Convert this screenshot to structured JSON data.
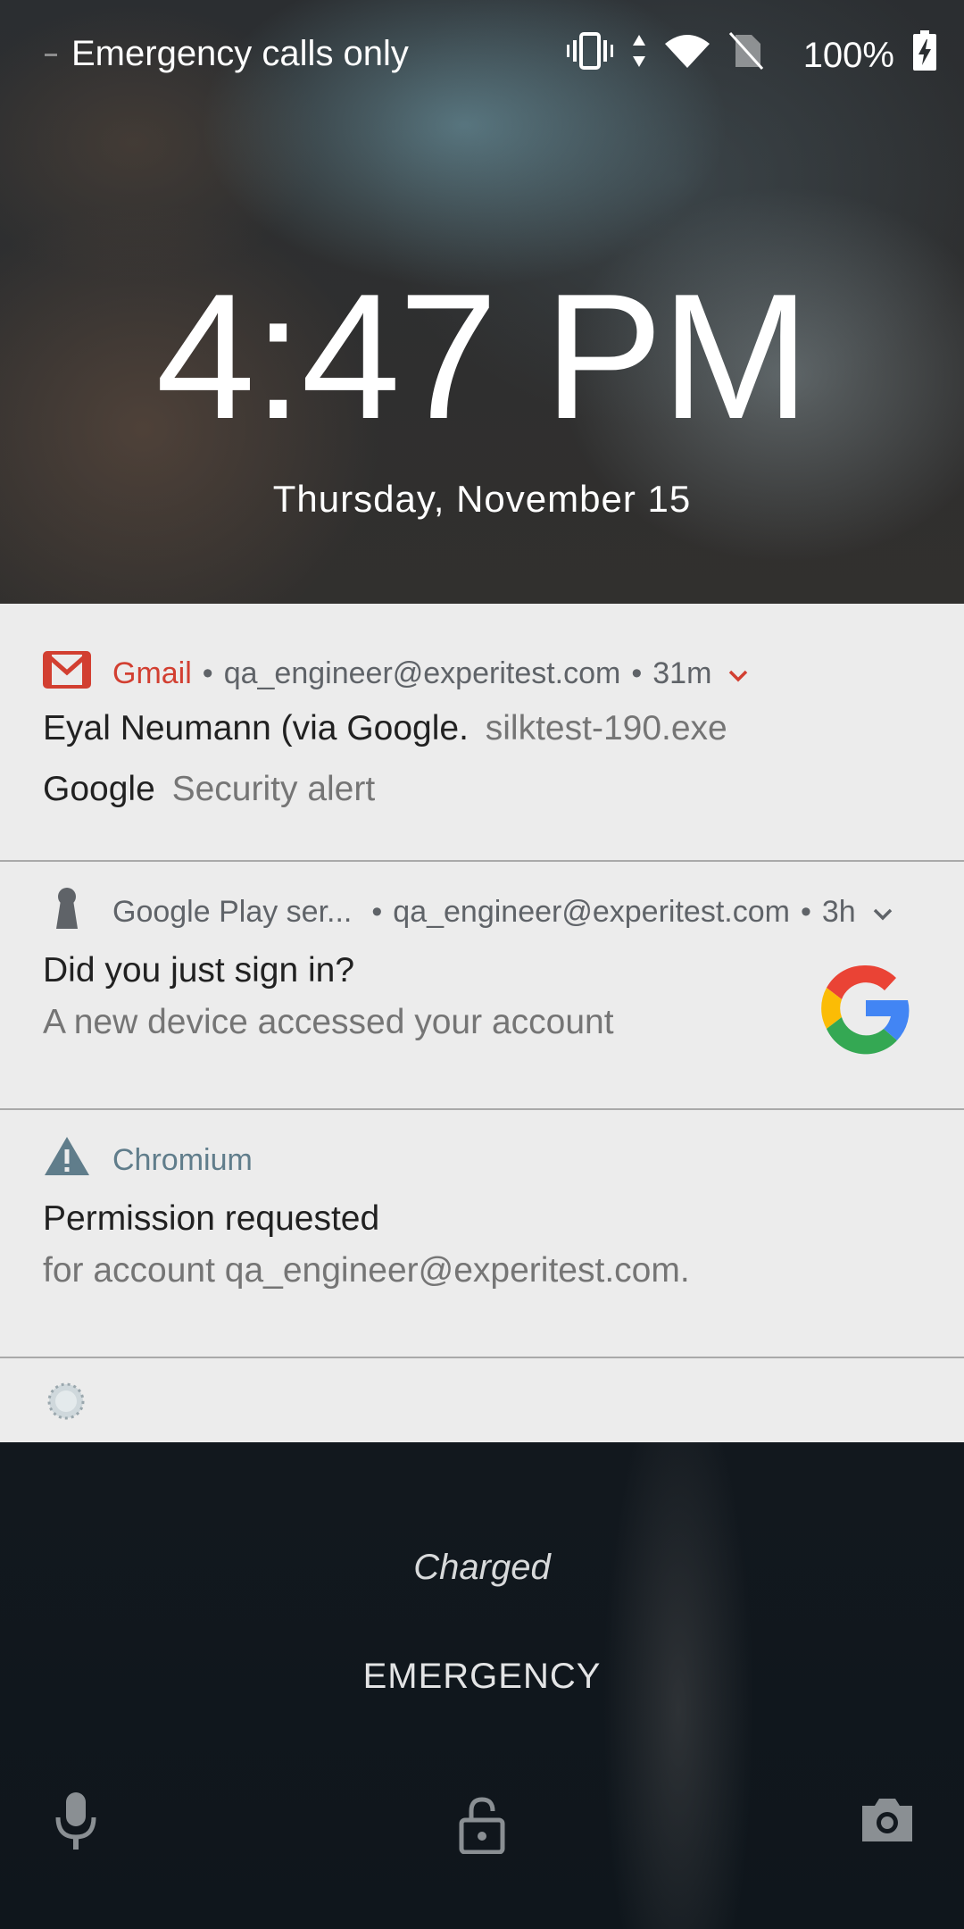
{
  "status_bar": {
    "carrier": "Emergency calls only",
    "battery_percent": "100%",
    "icons": [
      "vibrate-icon",
      "data-arrows-icon",
      "wifi-icon",
      "no-sim-icon",
      "battery-charging-icon"
    ]
  },
  "lockscreen": {
    "time": "4:47 PM",
    "date": "Thursday, November 15",
    "charging_status": "Charged",
    "emergency_label": "EMERGENCY",
    "bottom_icons": [
      "microphone-icon",
      "lock-icon",
      "camera-icon"
    ]
  },
  "notifications": [
    {
      "app": "Gmail",
      "account": "qa_engineer@experitest.com",
      "time": "31m",
      "line1_title": "Eyal Neumann (via Google.",
      "line1_text": "silktest-190.exe",
      "line2_title": "Google",
      "line2_text": "Security alert",
      "accent": "#d23f31"
    },
    {
      "app": "Google Play ser...",
      "account": "qa_engineer@experitest.com",
      "time": "3h",
      "title": "Did you just sign in?",
      "text": "A new device accessed your account",
      "large_icon": "google-g-logo"
    },
    {
      "app": "Chromium",
      "title": "Permission requested",
      "text": "for account qa_engineer@experitest.com.",
      "accent": "#607d8b"
    }
  ],
  "colors": {
    "gmail_red": "#d23f31",
    "chromium_gray_blue": "#607d8b",
    "notification_bg": "#ececec"
  }
}
